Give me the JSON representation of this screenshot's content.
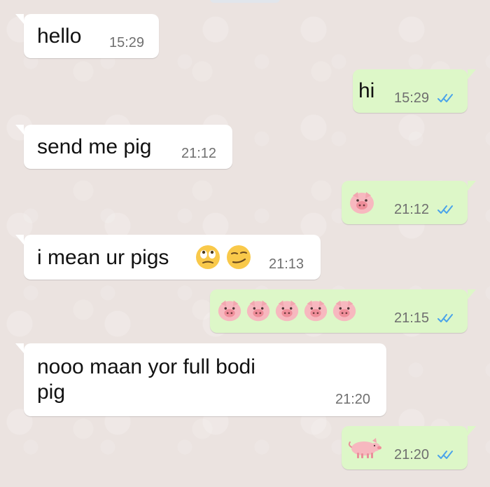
{
  "messages": [
    {
      "id": "m1",
      "type": "incoming",
      "text": "hello",
      "time": "15:29"
    },
    {
      "id": "m2",
      "type": "outgoing",
      "text": "hi",
      "time": "15:29",
      "ticks": "read"
    },
    {
      "id": "m3",
      "type": "incoming",
      "text": "send me pig",
      "time": "21:12"
    },
    {
      "id": "m4",
      "type": "outgoing",
      "emoji": [
        "pig-face"
      ],
      "time": "21:12",
      "ticks": "read"
    },
    {
      "id": "m5",
      "type": "incoming",
      "text": "i mean ur pigs",
      "emoji": [
        "face-with-rolling-eyes",
        "smirking-face"
      ],
      "time": "21:13"
    },
    {
      "id": "m6",
      "type": "outgoing",
      "emoji": [
        "pig-face",
        "pig-face",
        "pig-face",
        "pig-face",
        "pig-face"
      ],
      "time": "21:15",
      "ticks": "read"
    },
    {
      "id": "m7",
      "type": "incoming",
      "text_lines": [
        "nooo maan yor full bodi",
        "pig"
      ],
      "time": "21:20"
    },
    {
      "id": "m8",
      "type": "outgoing",
      "emoji": [
        "pig"
      ],
      "time": "21:20",
      "ticks": "read"
    }
  ],
  "colors": {
    "incoming_bubble": "#ffffff",
    "outgoing_bubble": "#ddf7c8",
    "background": "#ebe3e0",
    "timestamp": "#6f6f6f",
    "read_ticks": "#4aa3ea"
  }
}
